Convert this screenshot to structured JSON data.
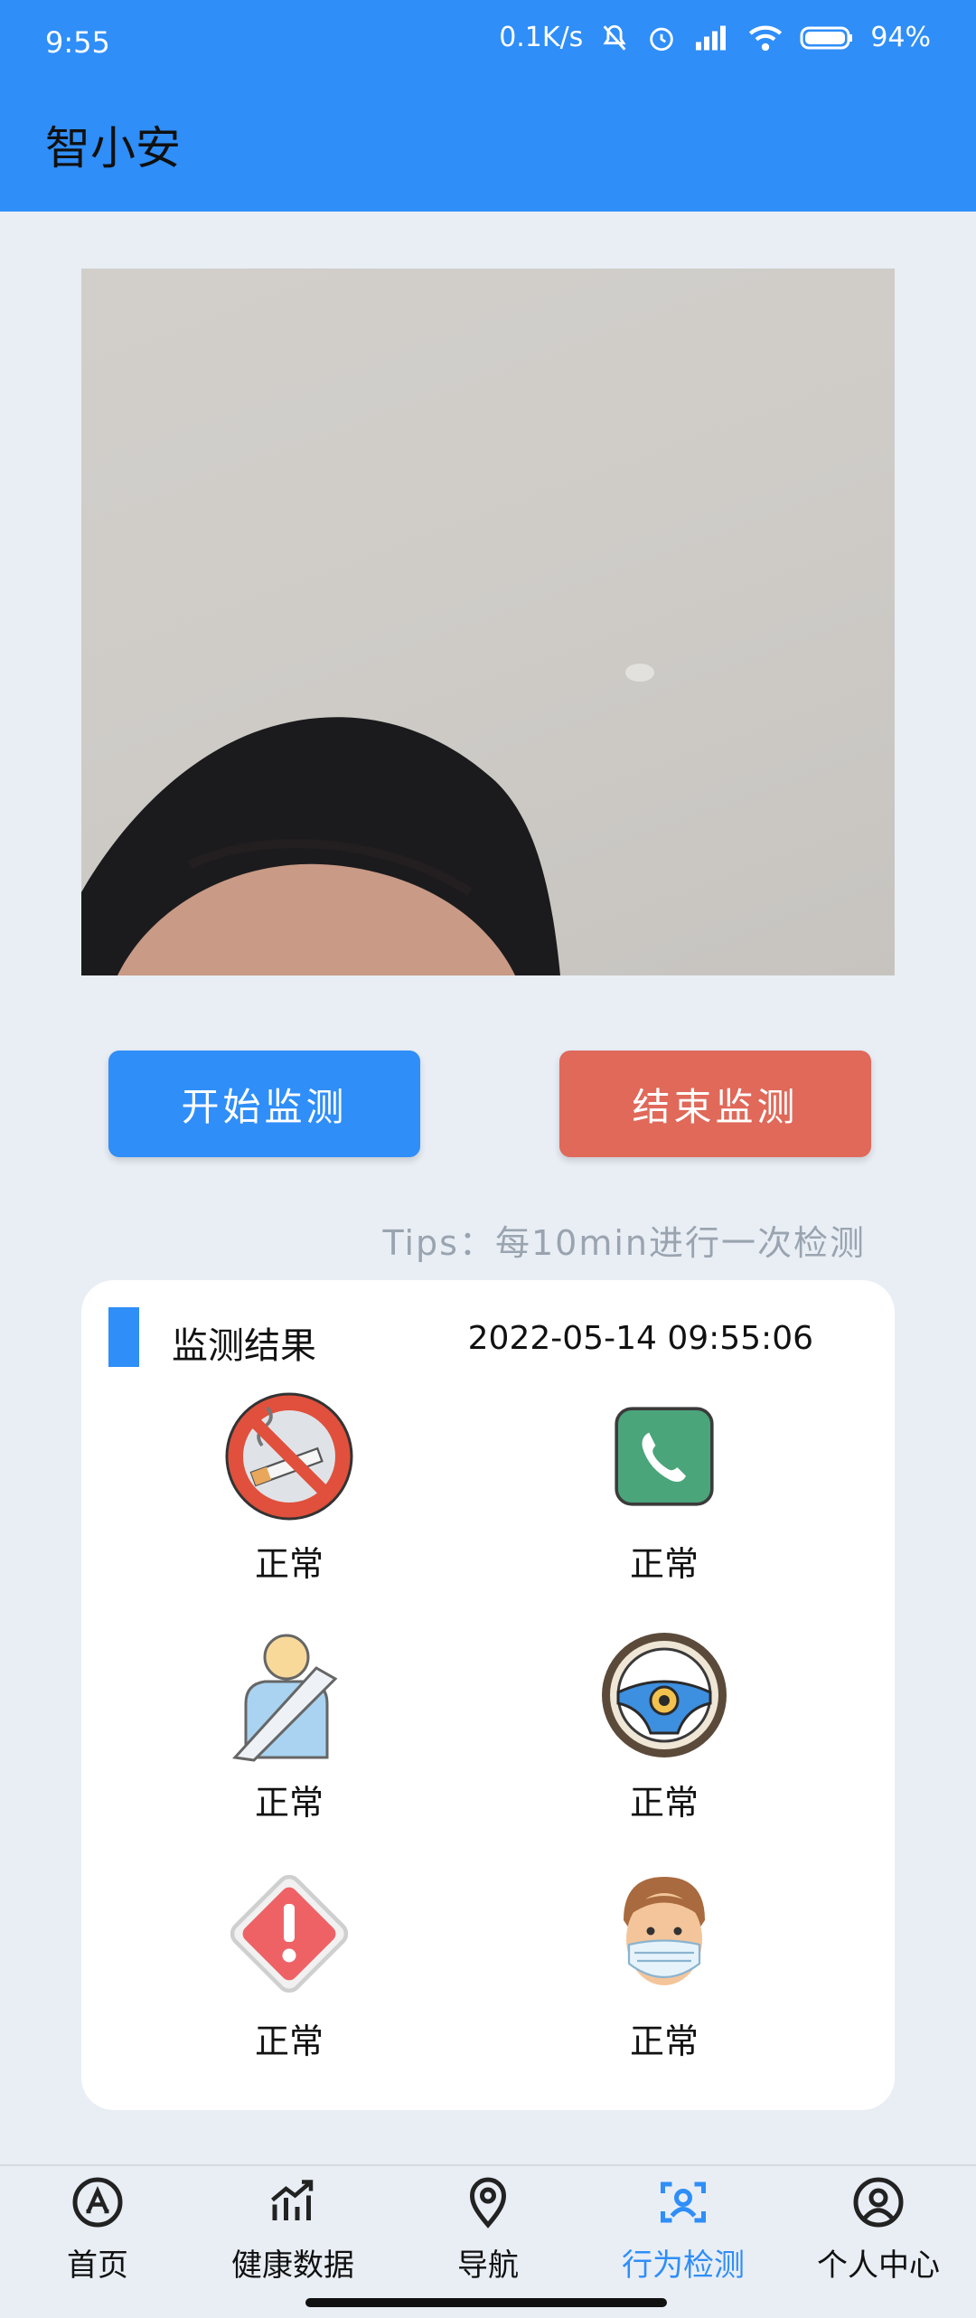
{
  "status_bar": {
    "time": "9:55",
    "net_speed": "0.1K/s",
    "battery": "94%"
  },
  "app": {
    "title": "智小安"
  },
  "controls": {
    "start_label": "开始监测",
    "stop_label": "结束监测",
    "tips": "Tips：每10min进行一次检测"
  },
  "results": {
    "title": "监测结果",
    "timestamp": "2022-05-14 09:55:06",
    "items": [
      {
        "icon": "no-smoking-icon",
        "status": "正常"
      },
      {
        "icon": "phone-icon",
        "status": "正常"
      },
      {
        "icon": "seatbelt-icon",
        "status": "正常"
      },
      {
        "icon": "steering-wheel-icon",
        "status": "正常"
      },
      {
        "icon": "warning-icon",
        "status": "正常"
      },
      {
        "icon": "face-mask-icon",
        "status": "正常"
      }
    ]
  },
  "nav": {
    "items": [
      {
        "label": "首页",
        "icon": "app-store-icon",
        "active": false
      },
      {
        "label": "健康数据",
        "icon": "chart-icon",
        "active": false
      },
      {
        "label": "导航",
        "icon": "location-pin-icon",
        "active": false
      },
      {
        "label": "行为检测",
        "icon": "face-scan-icon",
        "active": true
      },
      {
        "label": "个人中心",
        "icon": "user-circle-icon",
        "active": false
      }
    ]
  },
  "colors": {
    "primary": "#2f8ef8",
    "stop": "#e0695a",
    "background": "#e9eef5"
  }
}
